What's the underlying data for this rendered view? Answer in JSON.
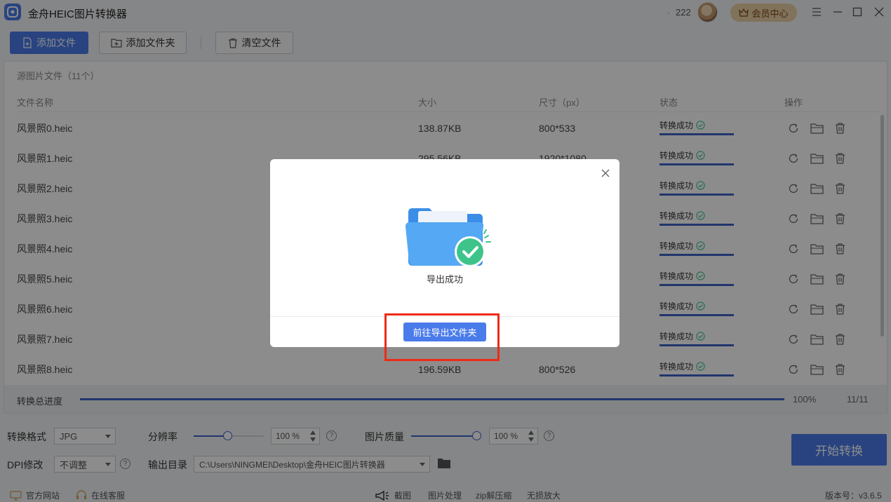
{
  "app": {
    "title": "金舟HEIC图片转换器",
    "dot": "·",
    "count": "222",
    "vip_label": "会员中心"
  },
  "toolbar": {
    "add_file": "添加文件",
    "add_folder": "添加文件夹",
    "clear": "清空文件"
  },
  "file_panel": {
    "title": "源图片文件（11个）",
    "columns": [
      "文件名称",
      "大小",
      "尺寸（px）",
      "状态",
      "操作"
    ],
    "rows": [
      {
        "name": "风景照0.heic",
        "size": "138.87KB",
        "dim": "800*533",
        "status": "转换成功"
      },
      {
        "name": "风景照1.heic",
        "size": "295.56KB",
        "dim": "1920*1080",
        "status": "转换成功"
      },
      {
        "name": "风景照2.heic",
        "size": "",
        "dim": "",
        "status": "转换成功"
      },
      {
        "name": "风景照3.heic",
        "size": "",
        "dim": "",
        "status": "转换成功"
      },
      {
        "name": "风景照4.heic",
        "size": "",
        "dim": "",
        "status": "转换成功"
      },
      {
        "name": "风景照5.heic",
        "size": "",
        "dim": "",
        "status": "转换成功"
      },
      {
        "name": "风景照6.heic",
        "size": "",
        "dim": "",
        "status": "转换成功"
      },
      {
        "name": "风景照7.heic",
        "size": "",
        "dim": "",
        "status": "转换成功"
      },
      {
        "name": "风景照8.heic",
        "size": "196.59KB",
        "dim": "800*526",
        "status": "转换成功"
      }
    ],
    "row_icons": [
      "refresh-icon",
      "folder-icon",
      "trash-icon"
    ]
  },
  "progress": {
    "label": "转换总进度",
    "percent_text": "100%",
    "count": "11/11",
    "fraction": 1.0
  },
  "settings": {
    "format_label": "转换格式",
    "format_value": "JPG",
    "resolution_label": "分辨率",
    "resolution_value": "100 %",
    "quality_label": "图片质量",
    "quality_value": "100 %",
    "dpi_label": "DPI修改",
    "dpi_value": "不调整",
    "output_label": "输出目录",
    "output_value": "C:\\Users\\NINGMEI\\Desktop\\金舟HEIC图片转换器",
    "help_glyph": "?",
    "start_button": "开始转换"
  },
  "footer": {
    "official_site": "官方网站",
    "online_service": "在线客服",
    "tools": [
      "截图",
      "图片处理",
      "zip解压缩",
      "无损放大"
    ],
    "version": "版本号：v3.6.5"
  },
  "dialog": {
    "message": "导出成功",
    "button": "前往导出文件夹"
  },
  "colors": {
    "accent": "#4a7bea",
    "success": "#3ec48a",
    "highlight": "#ef2a16",
    "vip": "#e9cfa6"
  }
}
